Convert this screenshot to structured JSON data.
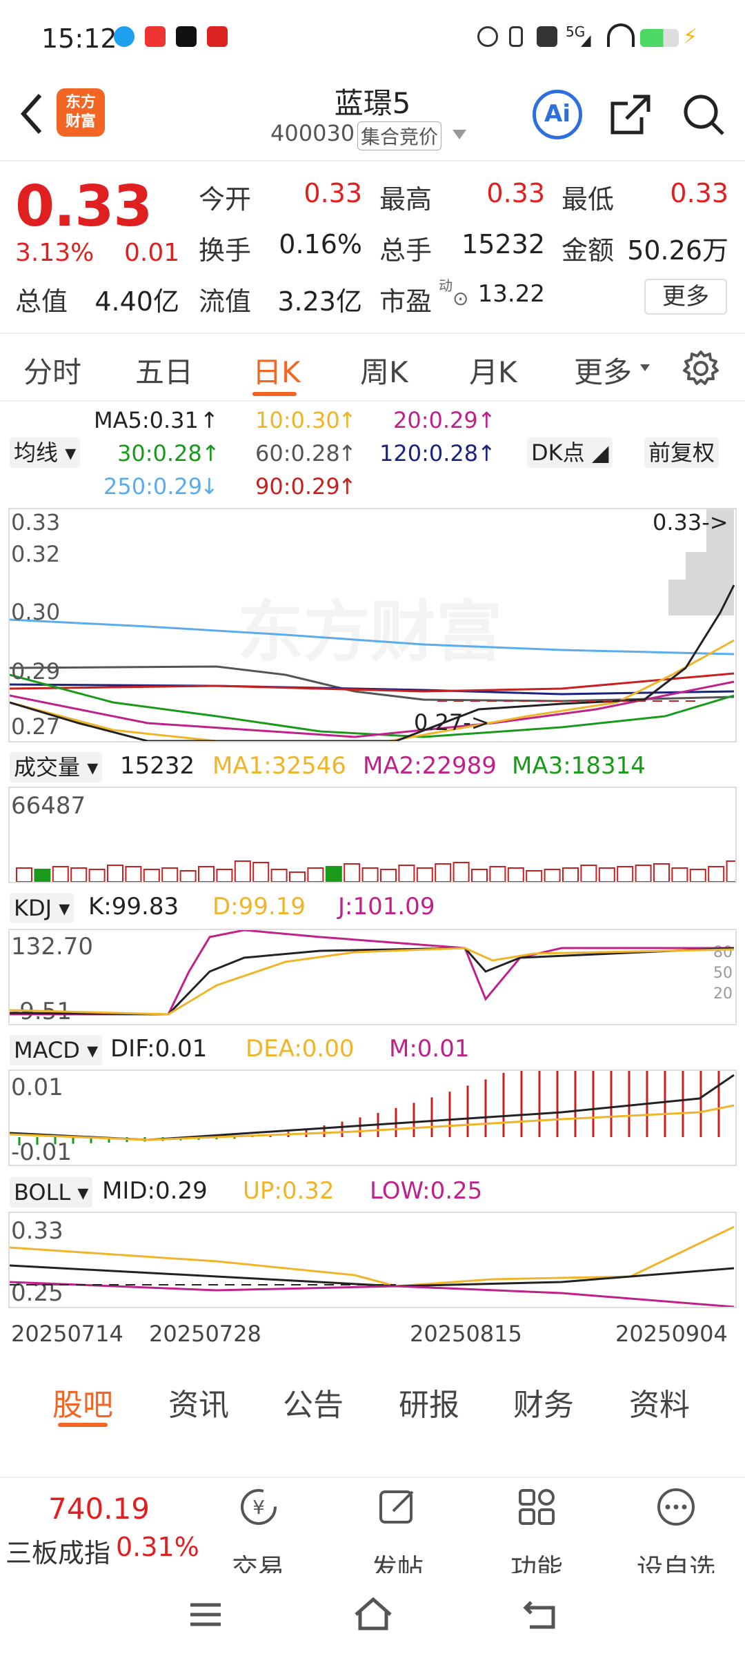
{
  "status_bar": {
    "time": "15:12",
    "network": "5G"
  },
  "header": {
    "logo_text": "东方\n财富",
    "stock_name": "蓝璟5",
    "stock_code": "400030",
    "auction_label": "集合竞价",
    "ai_label": "Ai"
  },
  "quote": {
    "price": "0.33",
    "change_pct": "3.13%",
    "change": "0.01",
    "open_label": "今开",
    "open": "0.33",
    "high_label": "最高",
    "high": "0.33",
    "low_label": "最低",
    "low": "0.33",
    "turnover_label": "换手",
    "turnover": "0.16%",
    "volume_label": "总手",
    "volume": "15232",
    "amount_label": "金额",
    "amount": "50.26万",
    "mktcap_label": "总值",
    "mktcap": "4.40亿",
    "float_label": "流值",
    "float": "3.23亿",
    "pe_label": "市盈",
    "pe_sup": "动",
    "pe": "13.22",
    "more": "更多"
  },
  "chart_tabs": [
    "分时",
    "五日",
    "日K",
    "周K",
    "月K",
    "更多"
  ],
  "ma_legend": {
    "selector": "均线",
    "ma5": "MA5:0.31",
    "ma10": "10:0.30",
    "ma20": "20:0.29",
    "ma30": "30:0.28",
    "ma60": "60:0.28",
    "ma120": "120:0.28",
    "ma250": "250:0.29",
    "ma90": "90:0.29",
    "dk": "DK点",
    "fq": "前复权",
    "colors": {
      "ma5": "#222222",
      "ma10": "#f0b429",
      "ma20": "#c0208a",
      "ma30": "#1a9a1a",
      "ma60": "#555555",
      "ma120": "#1a237e",
      "ma250": "#5aacec",
      "ma90": "#c82020"
    }
  },
  "kline": {
    "y_ticks": [
      "0.33",
      "0.32",
      "0.30",
      "0.29",
      "0.27"
    ],
    "last_label": "0.33->",
    "low_label": "0.27->",
    "watermark": "东方财富"
  },
  "volume": {
    "selector": "成交量",
    "value": "15232",
    "ma1": "MA1:32546",
    "ma2": "MA2:22989",
    "ma3": "MA3:18314",
    "max": "66487"
  },
  "kdj": {
    "selector": "KDJ",
    "k": "K:99.83",
    "d": "D:99.19",
    "j": "J:101.09",
    "top": "132.70",
    "bottom": "-9.51",
    "levels": [
      "80",
      "50",
      "20"
    ]
  },
  "macd": {
    "selector": "MACD",
    "dif": "DIF:0.01",
    "dea": "DEA:0.00",
    "m": "M:0.01",
    "top": "0.01",
    "bottom": "-0.01"
  },
  "boll": {
    "selector": "BOLL",
    "mid": "MID:0.29",
    "up": "UP:0.32",
    "low": "LOW:0.25",
    "top": "0.33",
    "bottom": "0.25"
  },
  "x_dates": [
    "20250714",
    "20250728",
    "20250815",
    "20250904"
  ],
  "bottom_tabs": [
    "股吧",
    "资讯",
    "公告",
    "研报",
    "财务",
    "资料"
  ],
  "bottom_bar": {
    "index_value": "740.19",
    "index_name": "三板成指",
    "index_pct": "0.31%",
    "trade": "交易",
    "post": "发帖",
    "func": "功能",
    "watch": "设自选"
  }
}
